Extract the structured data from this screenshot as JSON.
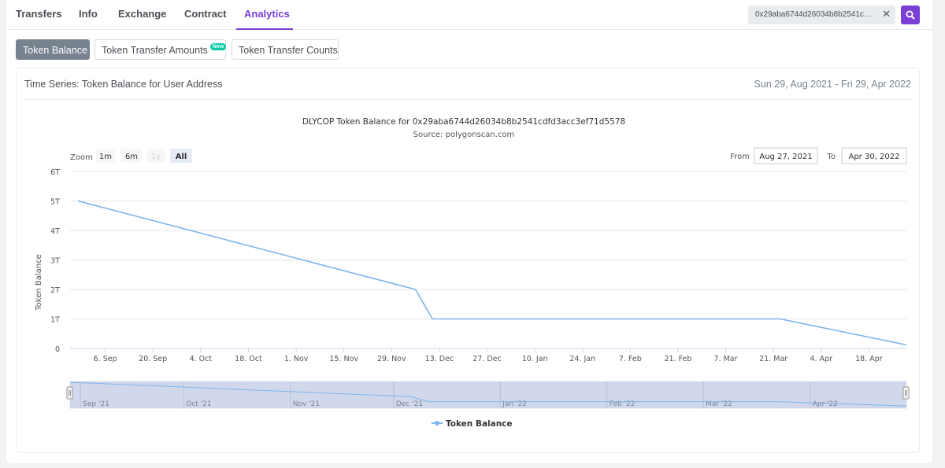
{
  "nav": {
    "tabs": [
      {
        "label": "Transfers",
        "active": false
      },
      {
        "label": "Info",
        "active": false
      },
      {
        "label": "Exchange",
        "active": false
      },
      {
        "label": "Contract",
        "active": false
      },
      {
        "label": "Analytics",
        "active": true
      }
    ],
    "search_value": "0x29aba6744d26034b8b2541cdfd...",
    "clear_icon": "close-icon",
    "search_icon": "search-icon"
  },
  "subtabs": [
    {
      "label": "Token Balance",
      "active": true
    },
    {
      "label": "Token Transfer Amounts",
      "badge": "New",
      "active": false
    },
    {
      "label": "Token Transfer Counts",
      "active": false
    }
  ],
  "card": {
    "title": "Time Series: Token Balance for User Address",
    "date_range": "Sun 29, Aug 2021 - Fri 29, Apr 2022"
  },
  "colors": {
    "accent": "#7a3fd6",
    "series": "#7cb5ec",
    "badge": "#00c9a7",
    "navigator": "#c9d1e8"
  },
  "chart_data": {
    "type": "line",
    "title": "DLYCOP Token Balance for 0x29aba6744d26034b8b2541cdfd3acc3ef71d5578",
    "subtitle": "Source: polygonscan.com",
    "xlabel": "",
    "ylabel": "Token Balance",
    "ylim": [
      0,
      6
    ],
    "y_unit": "T",
    "yticks": [
      "0",
      "1T",
      "2T",
      "3T",
      "4T",
      "5T",
      "6T"
    ],
    "xlim": [
      "2021-08-29",
      "2022-04-29"
    ],
    "xticks": [
      "6. Sep",
      "20. Sep",
      "4. Oct",
      "18. Oct",
      "1. Nov",
      "15. Nov",
      "29. Nov",
      "13. Dec",
      "27. Dec",
      "10. Jan",
      "24. Jan",
      "7. Feb",
      "21. Feb",
      "7. Mar",
      "21. Mar",
      "4. Apr",
      "18. Apr"
    ],
    "xtick_dates": [
      "2021-09-06",
      "2021-09-20",
      "2021-10-04",
      "2021-10-18",
      "2021-11-01",
      "2021-11-15",
      "2021-11-29",
      "2021-12-13",
      "2021-12-27",
      "2022-01-10",
      "2022-01-24",
      "2022-02-07",
      "2022-02-21",
      "2022-03-07",
      "2022-03-21",
      "2022-04-04",
      "2022-04-18"
    ],
    "series": [
      {
        "name": "Token Balance",
        "points": [
          {
            "x": "2021-08-29",
            "y": 5.0
          },
          {
            "x": "2021-12-06",
            "y": 2.0
          },
          {
            "x": "2021-12-11",
            "y": 1.0
          },
          {
            "x": "2022-03-23",
            "y": 1.0
          },
          {
            "x": "2022-04-29",
            "y": 0.12
          }
        ]
      }
    ],
    "grid": true,
    "legend": "bottom-center",
    "zoom": {
      "label": "Zoom",
      "options": [
        "1m",
        "6m",
        "1y",
        "All"
      ],
      "selected": "All",
      "disabled": [
        "1y"
      ]
    },
    "range": {
      "from_label": "From",
      "from": "Aug 27, 2021",
      "to_label": "To",
      "to": "Apr 30, 2022"
    },
    "navigator_ticks": [
      "Sep '21",
      "Oct '21",
      "Nov '21",
      "Dec '21",
      "Jan '22",
      "Feb '22",
      "Mar '22",
      "Apr '22"
    ],
    "navigator_tick_dates": [
      "2021-09-01",
      "2021-10-01",
      "2021-11-01",
      "2021-12-01",
      "2022-01-01",
      "2022-02-01",
      "2022-03-01",
      "2022-04-01"
    ]
  }
}
